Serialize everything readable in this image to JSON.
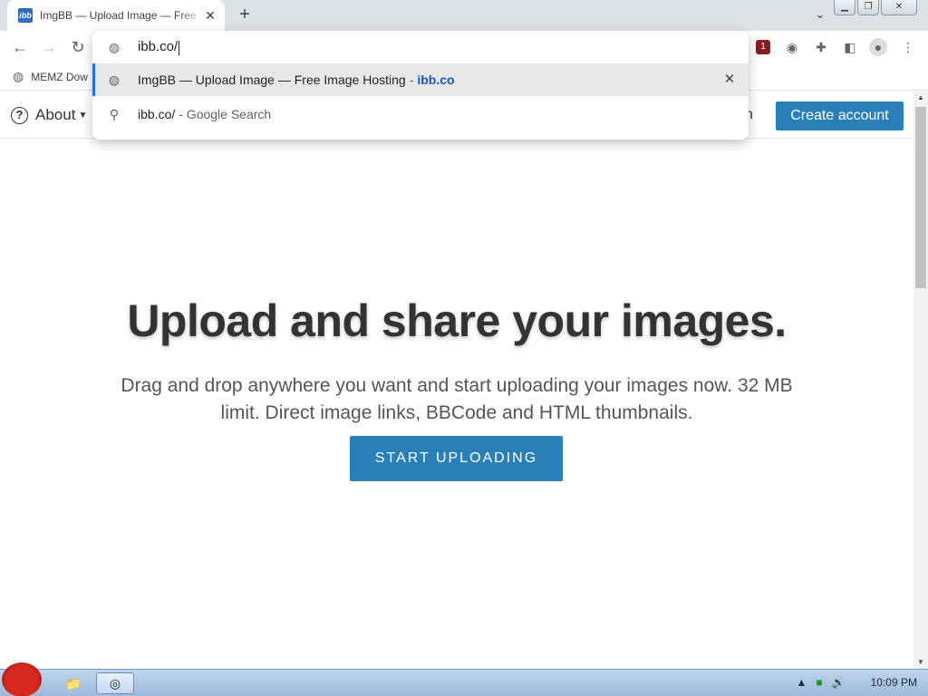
{
  "tab": {
    "favicon_text": "ibb",
    "title": "ImgBB — Upload Image — Free Image Hosting",
    "close_glyph": "✕"
  },
  "newtab_glyph": "+",
  "toolbar": {
    "back": "←",
    "forward": "→",
    "reload": "↻",
    "extension_badge": "1"
  },
  "omnibox": {
    "input_value": "ibb.co/",
    "suggestions": [
      {
        "title": "ImgBB — Upload Image — Free Image Hosting",
        "separator": "-",
        "url": "ibb.co"
      },
      {
        "title": "ibb.co/",
        "suffix": "- Google Search"
      }
    ],
    "remove_glyph": "✕"
  },
  "bookmarks": [
    {
      "label": "MEMZ Dow"
    }
  ],
  "site": {
    "about_label": "About",
    "signin_fragment": "n",
    "create_account": "Create account",
    "headline": "Upload and share your images.",
    "subtitle": "Drag and drop anywhere you want and start uploading your images now. 32 MB limit. Direct image links, BBCode and HTML thumbnails.",
    "cta": "START UPLOADING"
  },
  "taskbar": {
    "clock": "10:09 PM"
  },
  "colors": {
    "brand_blue": "#2980b9",
    "tab_strip": "#dee1e6",
    "url_blue": "#1a57b5"
  }
}
